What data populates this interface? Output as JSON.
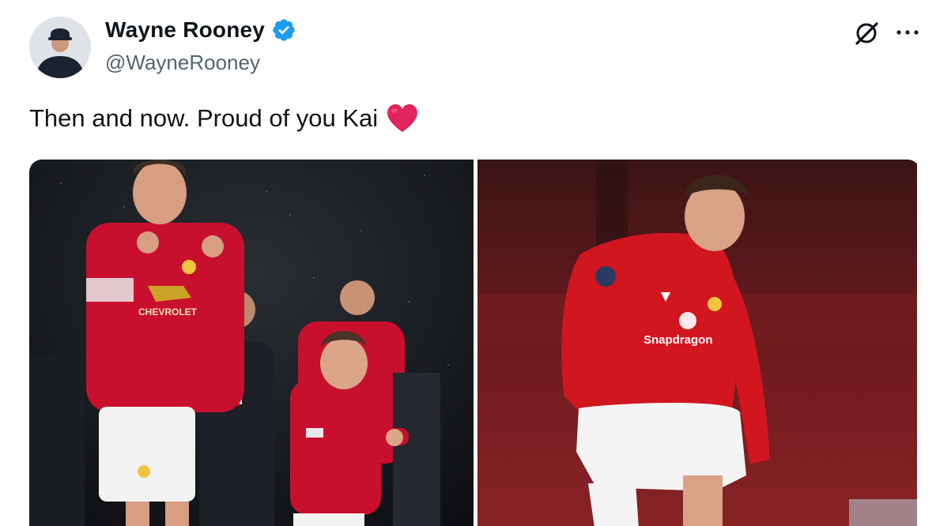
{
  "author": {
    "display_name": "Wayne Rooney",
    "handle": "@WayneRooney",
    "verified": true,
    "avatar_icon": "person-avatar"
  },
  "actions": {
    "grok_icon": "grok-icon",
    "more_icon": "more-options-icon"
  },
  "tweet": {
    "text": "Then and now. Proud of you Kai",
    "emoji_icon": "red-heart-icon"
  },
  "media": {
    "photos": [
      {
        "description_icon": "photo-then",
        "kit_sponsor": "CHEVROLET"
      },
      {
        "description_icon": "photo-now",
        "kit_sponsor": "Snapdragon"
      }
    ]
  },
  "colors": {
    "verified_blue": "#1d9bf0",
    "handle_gray": "#536471",
    "kit_red": "#c8102e",
    "heart_red": "#e0245e"
  }
}
